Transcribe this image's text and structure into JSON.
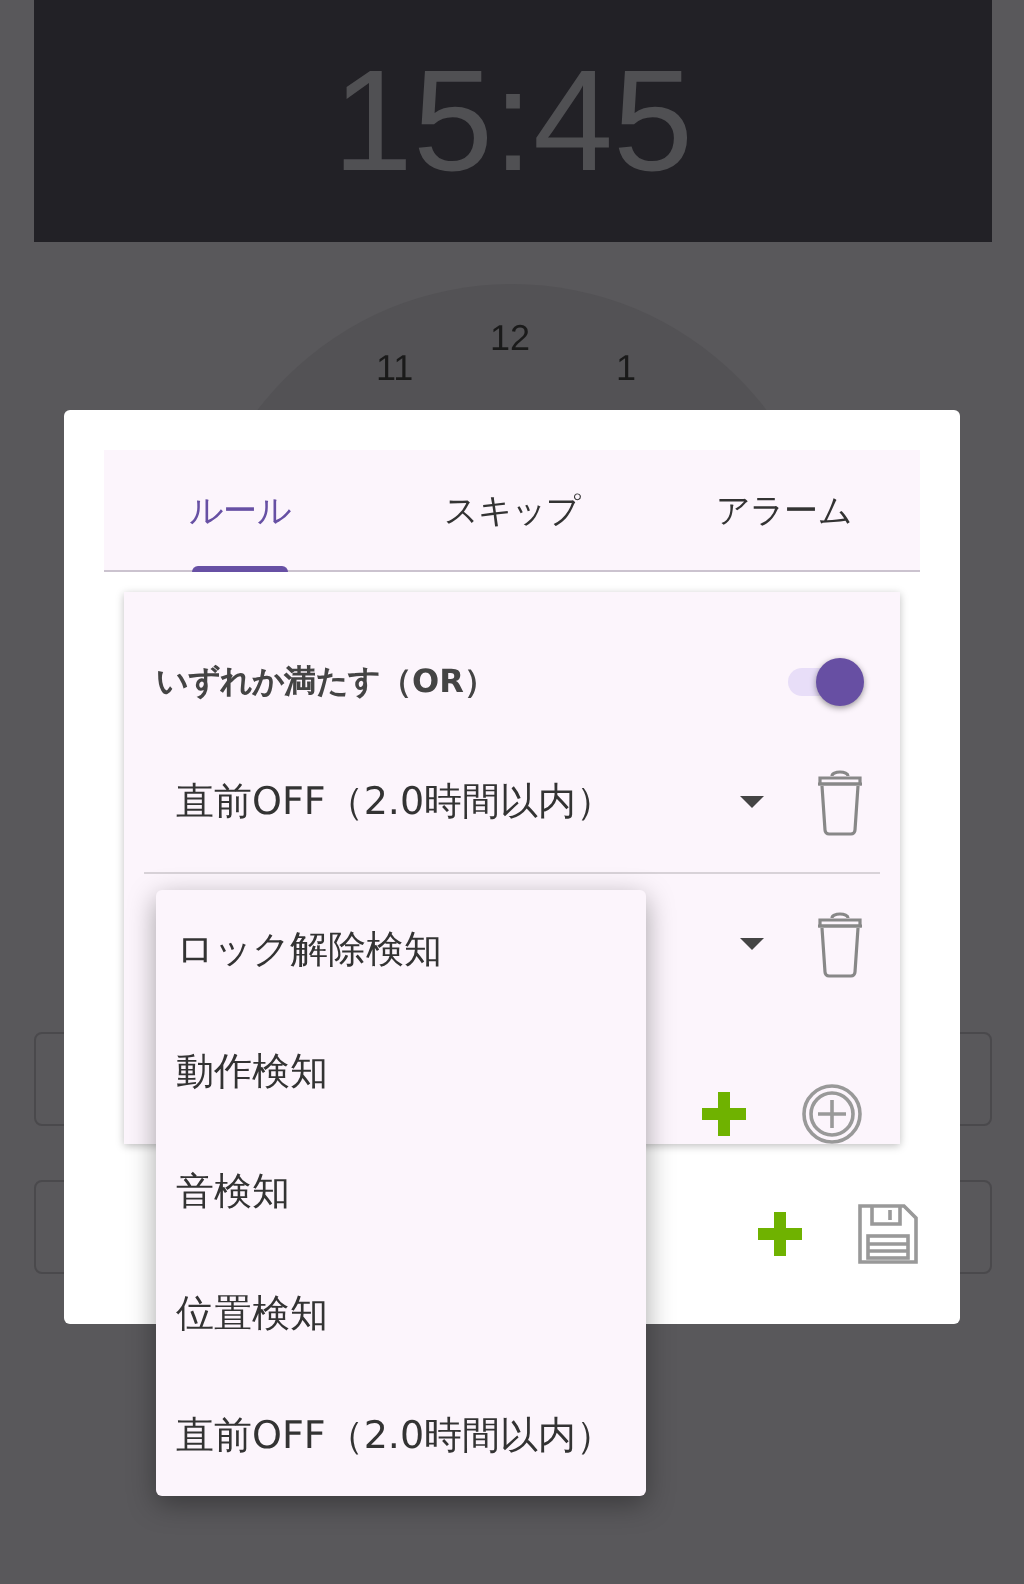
{
  "clock": {
    "time": "15:45",
    "dial_numbers": [
      "11",
      "12",
      "1"
    ]
  },
  "dialog": {
    "tabs": [
      {
        "label": "ルール",
        "selected": true
      },
      {
        "label": "スキップ",
        "selected": false
      },
      {
        "label": "アラーム",
        "selected": false
      }
    ],
    "match_any": {
      "label": "いずれか満たす（OR）",
      "on": true
    },
    "conditions": [
      {
        "value": "直前OFF（2.0時間以内）",
        "expanded": false
      },
      {
        "expanded": true
      }
    ]
  },
  "dropdown_menu": {
    "options": [
      "ロック解除検知",
      "動作検知",
      "音検知",
      "位置検知",
      "直前OFF（2.0時間以内）"
    ]
  }
}
